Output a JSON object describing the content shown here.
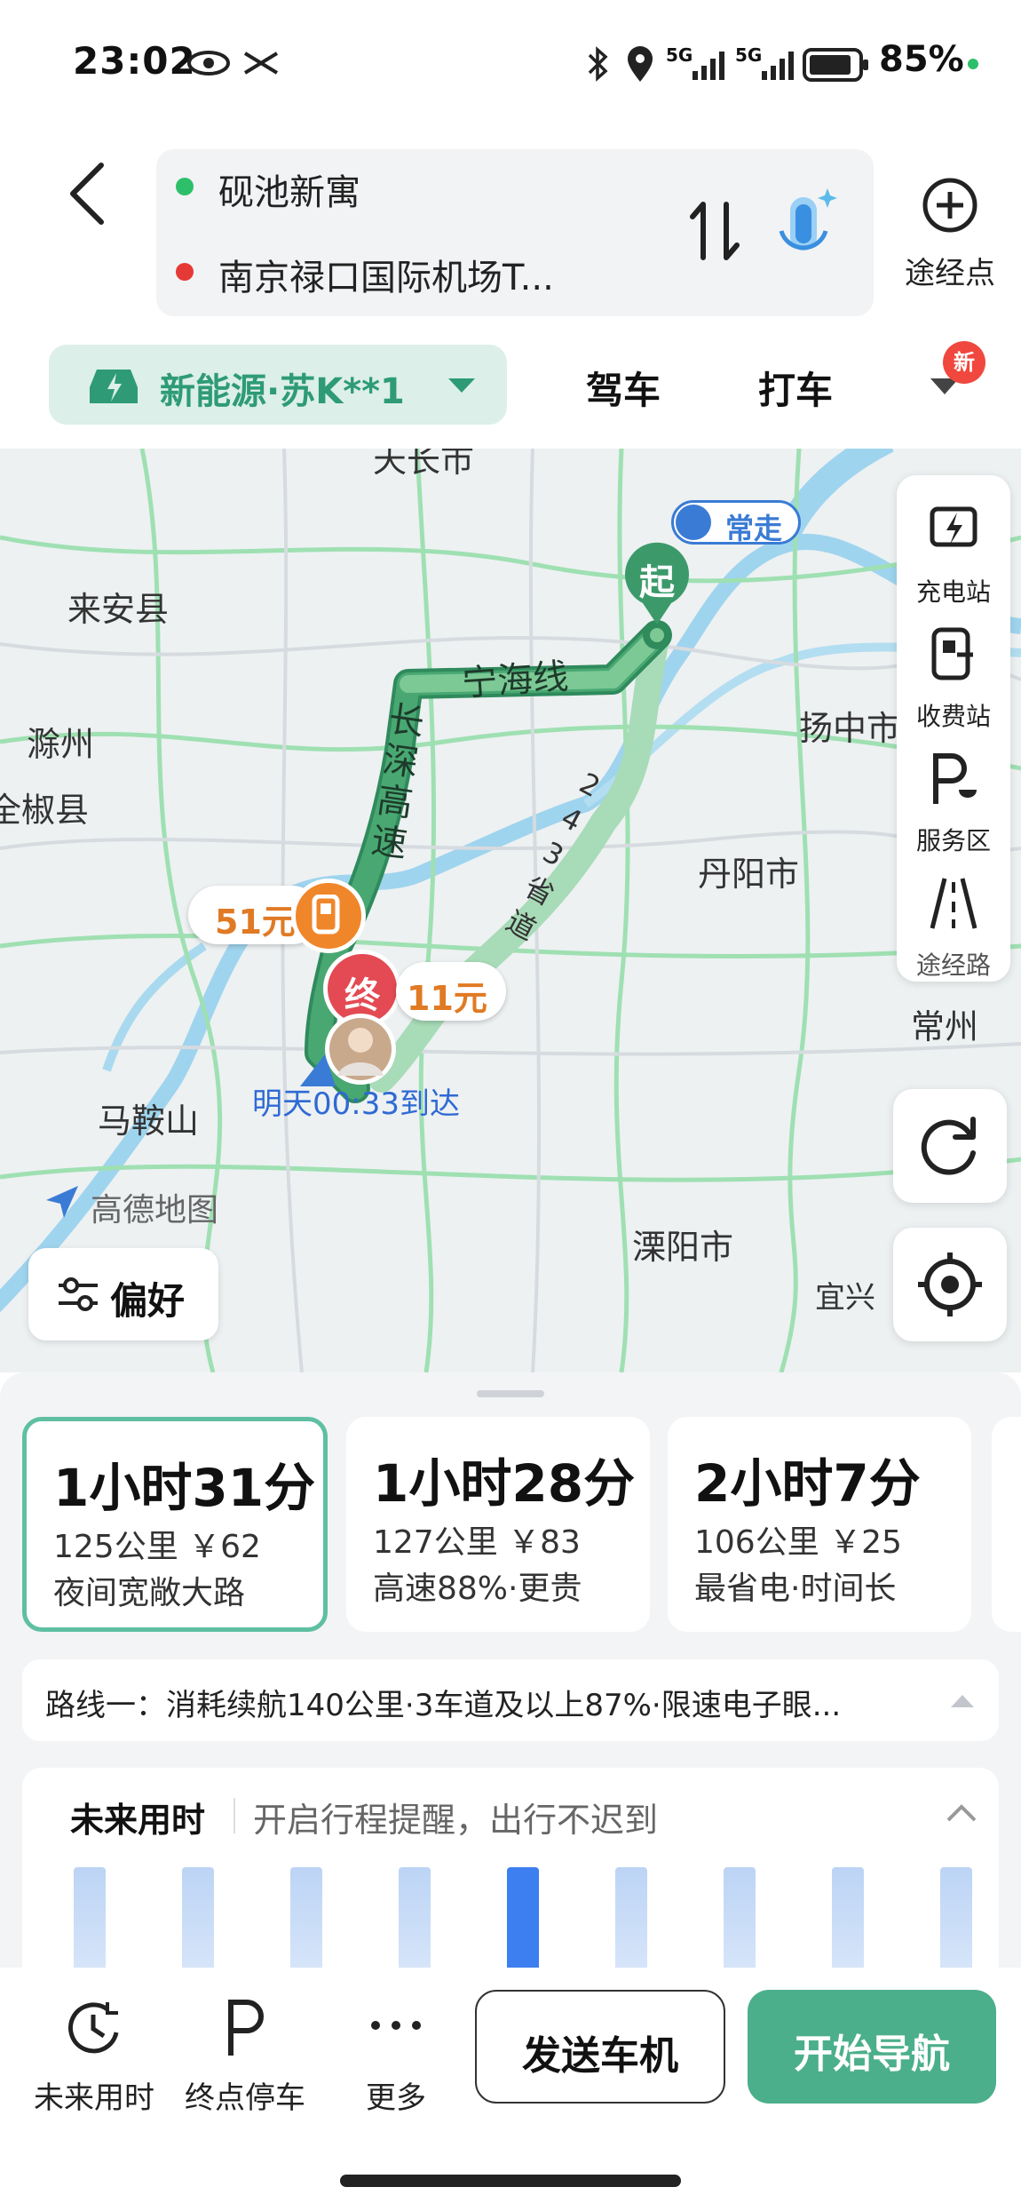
{
  "status_bar": {
    "time": "23:02",
    "battery": "85%",
    "network1": "5G",
    "network2": "5G"
  },
  "route": {
    "from": "砚池新寓",
    "to": "南京禄口国际机场T...",
    "from_color": "#2dbf6a",
    "to_color": "#e53935",
    "waypoint_label": "途经点"
  },
  "tabs": {
    "vehicle": "新能源·苏K**1",
    "drive": "驾车",
    "taxi": "打车",
    "new_badge": "新"
  },
  "map": {
    "labels": {
      "laian": "来安县",
      "chuzhou": "滁州",
      "quanjiao": "全椒县",
      "danyang": "丹阳市",
      "yangzhong": "扬中市",
      "changzhou": "常州",
      "maanshan": "马鞍山",
      "liyang": "溧阳市",
      "yixing": "宜兴",
      "tianchang": "天长市"
    },
    "route_labels": {
      "ninghai": "宁海线",
      "changshen": "长深高速",
      "shengdao": "243省道",
      "changzou": "常走"
    },
    "start_label": "起",
    "end_label": "终",
    "toll1": "51元",
    "toll2": "11元",
    "arrival": "明天00:33到达",
    "brand": "高德地图",
    "tools": [
      "充电站",
      "收费站",
      "服务区",
      "途经路"
    ],
    "pref": "偏好"
  },
  "routes": [
    {
      "time": "1小时31分",
      "detail": "125公里 ￥62",
      "note": "夜间宽敞大路"
    },
    {
      "time": "1小时28分",
      "detail": "127公里 ￥83",
      "note": "高速88%·更贵"
    },
    {
      "time": "2小时7分",
      "detail": "106公里 ￥25",
      "note": "最省电·时间长"
    }
  ],
  "route_desc": "路线一：消耗续航140公里·3车道及以上87%·限速电子眼...",
  "future": {
    "title": "未来用时",
    "hint": "开启行程提醒，出行不迟到",
    "selected_index": 4
  },
  "toolbar": {
    "future_time": "未来用时",
    "parking": "终点停车",
    "more": "更多",
    "send": "发送车机",
    "start": "开始导航"
  },
  "colors": {
    "accent": "#4caf8b",
    "route_green": "#3c9a6a",
    "toll_orange": "#f0862a"
  }
}
